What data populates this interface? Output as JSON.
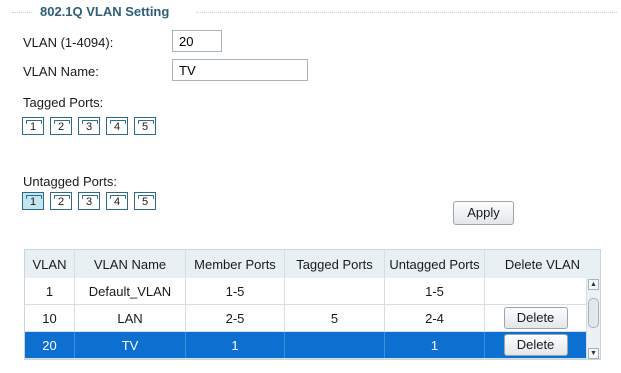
{
  "section_title": "802.1Q VLAN Setting",
  "form": {
    "vlan_id_label": "VLAN (1-4094):",
    "vlan_id_value": "20",
    "vlan_name_label": "VLAN Name:",
    "vlan_name_value": "TV",
    "tagged_ports_label": "Tagged Ports:",
    "untagged_ports_label": "Untagged Ports:",
    "tagged_ports": [
      {
        "label": "1",
        "checked": false
      },
      {
        "label": "2",
        "checked": false
      },
      {
        "label": "3",
        "checked": false
      },
      {
        "label": "4",
        "checked": false
      },
      {
        "label": "5",
        "checked": false
      }
    ],
    "untagged_ports": [
      {
        "label": "1",
        "checked": true
      },
      {
        "label": "2",
        "checked": false
      },
      {
        "label": "3",
        "checked": false
      },
      {
        "label": "4",
        "checked": false
      },
      {
        "label": "5",
        "checked": false
      }
    ],
    "apply_label": "Apply"
  },
  "table": {
    "headers": [
      "VLAN",
      "VLAN Name",
      "Member Ports",
      "Tagged Ports",
      "Untagged Ports",
      "Delete VLAN"
    ],
    "delete_label": "Delete",
    "rows": [
      {
        "vlan": "1",
        "name": "Default_VLAN",
        "member": "1-5",
        "tagged": "",
        "untagged": "1-5",
        "deletable": false,
        "selected": false
      },
      {
        "vlan": "10",
        "name": "LAN",
        "member": "2-5",
        "tagged": "5",
        "untagged": "2-4",
        "deletable": true,
        "selected": false
      },
      {
        "vlan": "20",
        "name": "TV",
        "member": "1",
        "tagged": "",
        "untagged": "1",
        "deletable": true,
        "selected": true
      }
    ]
  },
  "colors": {
    "accent_title": "#2e5f7a",
    "header_bg": "#e8f0f4",
    "selected_row": "#0d6fd0",
    "port_checked": "#c4e6ef"
  }
}
